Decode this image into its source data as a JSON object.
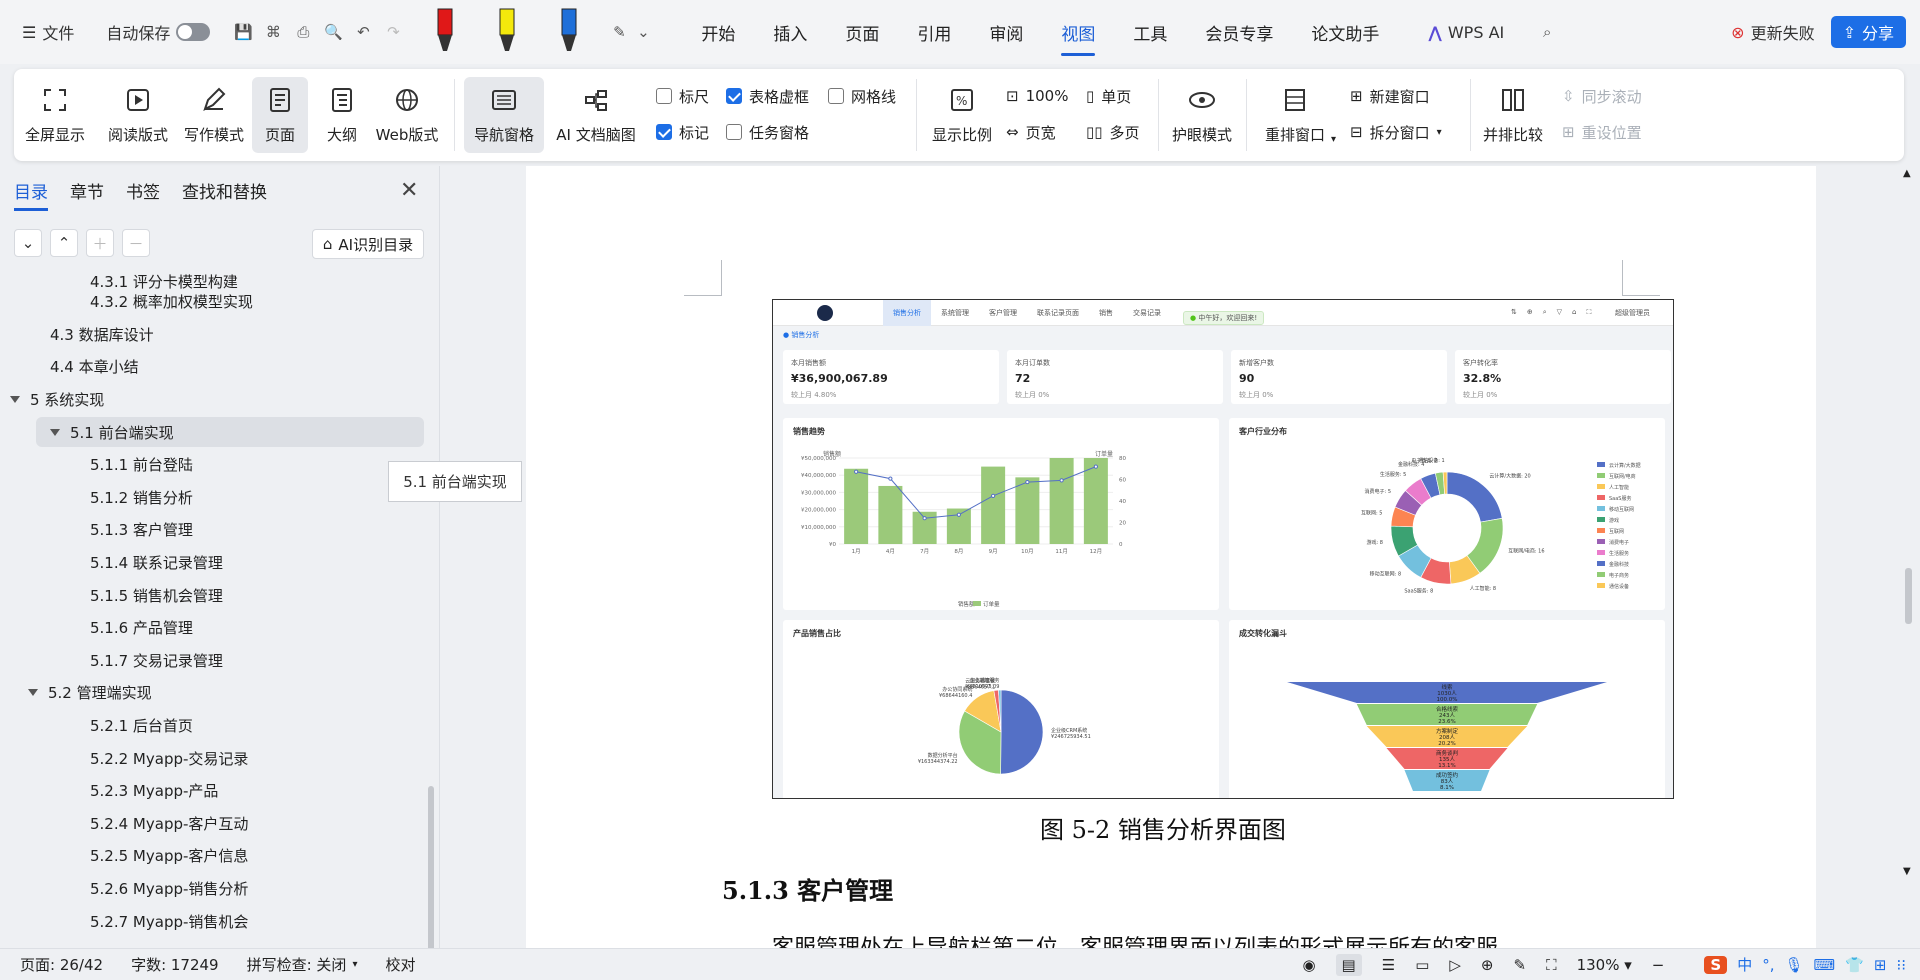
{
  "topbar": {
    "file_label": "文件",
    "autosave_label": "自动保存",
    "menu_tabs": [
      "开始",
      "插入",
      "页面",
      "引用",
      "审阅",
      "视图",
      "工具",
      "会员专享",
      "论文助手"
    ],
    "active_tab": "视图",
    "wps_ai_label": "WPS AI",
    "update_failed_label": "更新失败",
    "share_label": "分享"
  },
  "ribbon": {
    "fullscreen": "全屏显示",
    "reading": "阅读版式",
    "writing": "写作模式",
    "page": "页面",
    "outline": "大纲",
    "web": "Web版式",
    "nav_pane": "导航窗格",
    "ai_mindmap": "AI 文档脑图",
    "ruler": "标尺",
    "table_grid": "表格虚框",
    "gridlines": "网格线",
    "marks": "标记",
    "task_pane": "任务窗格",
    "zoom_ratio": "显示比例",
    "zoom_100": "100%",
    "page_width": "页宽",
    "single_page": "单页",
    "multi_page": "多页",
    "eye_mode": "护眼模式",
    "rearrange": "重排窗口",
    "new_window": "新建窗口",
    "split_window": "拆分窗口",
    "side_by_side": "并排比较",
    "sync_scroll": "同步滚动",
    "reset_position": "重设位置"
  },
  "leftpane": {
    "tabs": [
      "目录",
      "章节",
      "书签",
      "查找和替换"
    ],
    "ai_toc_label": "AI识别目录",
    "toc": [
      {
        "text": "4.3.1 评分卡模型构建",
        "level": 3
      },
      {
        "text": "4.3.2 概率加权模型实现",
        "level": 3
      },
      {
        "text": "4.3 数据库设计",
        "level": 2
      },
      {
        "text": "4.4 本章小结",
        "level": 2
      },
      {
        "text": "5 系统实现",
        "level": 1
      },
      {
        "text": "5.1 前台端实现",
        "level": 2
      },
      {
        "text": "5.1.1 前台登陆",
        "level": 3
      },
      {
        "text": "5.1.2 销售分析",
        "level": 3
      },
      {
        "text": "5.1.3 客户管理",
        "level": 3
      },
      {
        "text": "5.1.4 联系记录管理",
        "level": 3
      },
      {
        "text": "5.1.5 销售机会管理",
        "level": 3
      },
      {
        "text": "5.1.6 产品管理",
        "level": 3
      },
      {
        "text": "5.1.7 交易记录管理",
        "level": 3
      },
      {
        "text": "5.2 管理端实现",
        "level": 2
      },
      {
        "text": "5.2.1 后台首页",
        "level": 3
      },
      {
        "text": "5.2.2 Myapp-交易记录",
        "level": 3
      },
      {
        "text": "5.2.3 Myapp-产品",
        "level": 3
      },
      {
        "text": "5.2.4 Myapp-客户互动",
        "level": 3
      },
      {
        "text": "5.2.5 Myapp-客户信息",
        "level": 3
      },
      {
        "text": "5.2.6 Myapp-销售分析",
        "level": 3
      },
      {
        "text": "5.2.7 Myapp-销售机会",
        "level": 3
      }
    ],
    "tooltip": "5.1 前台端实现"
  },
  "document": {
    "figure_caption": "图 5-2  销售分析界面图",
    "section_heading": "5.1.3  客户管理",
    "paragraph": "客服管理处在上导航栏第二位，客服管理界面以列表的形式展示所有的客服"
  },
  "screenshot": {
    "nav": [
      "销售分析",
      "系统管理",
      "客户管理",
      "联系记录页面",
      "销售",
      "交易记录"
    ],
    "welcome": "中午好，欢迎回来!",
    "user": "超级管理员",
    "breadcrumb": "销售分析",
    "kpis": [
      {
        "label": "本月销售额",
        "value": "¥36,900,067.89",
        "sub": "较上月 4.80%"
      },
      {
        "label": "本月订单数",
        "value": "72",
        "sub": "较上月 0%"
      },
      {
        "label": "新增客户数",
        "value": "90",
        "sub": "较上月 0%"
      },
      {
        "label": "客户转化率",
        "value": "32.8%",
        "sub": "较上月 0%"
      }
    ],
    "card_titles": [
      "销售趋势",
      "客户行业分布",
      "产品销售占比",
      "成交转化漏斗"
    ]
  },
  "chart_data": [
    {
      "type": "bar",
      "title": "销售趋势",
      "categories": [
        "1月",
        "4月",
        "7月",
        "8月",
        "9月",
        "10月",
        "11月",
        "12月"
      ],
      "series": [
        {
          "name": "销售额",
          "type": "line",
          "values": [
            42000000,
            38000000,
            15000000,
            17000000,
            28000000,
            36000000,
            37000000,
            45000000
          ]
        },
        {
          "name": "订单量",
          "type": "bar",
          "values": [
            70,
            54,
            30,
            33,
            72,
            62,
            80,
            80
          ]
        }
      ],
      "ylabel_left": "销售额",
      "ylabel_right": "订单量",
      "y_ticks_left": [
        "¥0",
        "¥10,000,000",
        "¥20,000,000",
        "¥30,000,000",
        "¥40,000,000",
        "¥50,000,000"
      ],
      "y_ticks_right": [
        "0",
        "20",
        "40",
        "60",
        "80"
      ]
    },
    {
      "type": "pie",
      "title": "客户行业分布",
      "labels": [
        "云计算/大数据",
        "互联网/电商",
        "人工智能",
        "SaaS服务",
        "移动互联网",
        "游戏",
        "互联网",
        "消费电子",
        "生活服务",
        "金融科技",
        "电子商务",
        "通信设备"
      ],
      "values": [
        20,
        16,
        8,
        8,
        8,
        8,
        5,
        5,
        5,
        4,
        2,
        1
      ],
      "colors": [
        "#5470c6",
        "#91cc75",
        "#fac858",
        "#ee6666",
        "#73c0de",
        "#3ba272",
        "#fc8452",
        "#9a60b4",
        "#ea7ccc",
        "#5470c6",
        "#91cc75",
        "#fac858"
      ]
    },
    {
      "type": "pie",
      "title": "产品销售占比",
      "labels": [
        "企业级CRM系统",
        "数据分析平台",
        "办公协同系统",
        "云服务器套餐",
        "企业邮箱服务"
      ],
      "values": [
        246725934.51,
        163344374.22,
        68644160.4,
        8564657.1,
        4810593.09
      ],
      "data_labels": [
        "¥246725934.51",
        "¥163344374.22",
        "¥68644160.4",
        "¥8564657.1",
        "¥4810593.09"
      ],
      "colors": [
        "#5470c6",
        "#91cc75",
        "#fac858",
        "#ee6666",
        "#73c0de"
      ]
    },
    {
      "type": "funnel",
      "title": "成交转化漏斗",
      "labels": [
        "线索",
        "合格线索",
        "方案制定",
        "商务谈判",
        "成功签约"
      ],
      "values": [
        1030,
        243,
        208,
        135,
        83
      ],
      "percent": [
        "100.0%",
        "23.6%",
        "20.2%",
        "13.1%",
        "8.1%"
      ],
      "colors": [
        "#5470c6",
        "#91cc75",
        "#fac858",
        "#ee6666",
        "#73c0de"
      ]
    }
  ],
  "statusbar": {
    "page": "页面: 26/42",
    "words": "字数: 17249",
    "spell": "拼写检查: 关闭",
    "proof": "校对",
    "zoom": "130%",
    "ime": "中"
  }
}
